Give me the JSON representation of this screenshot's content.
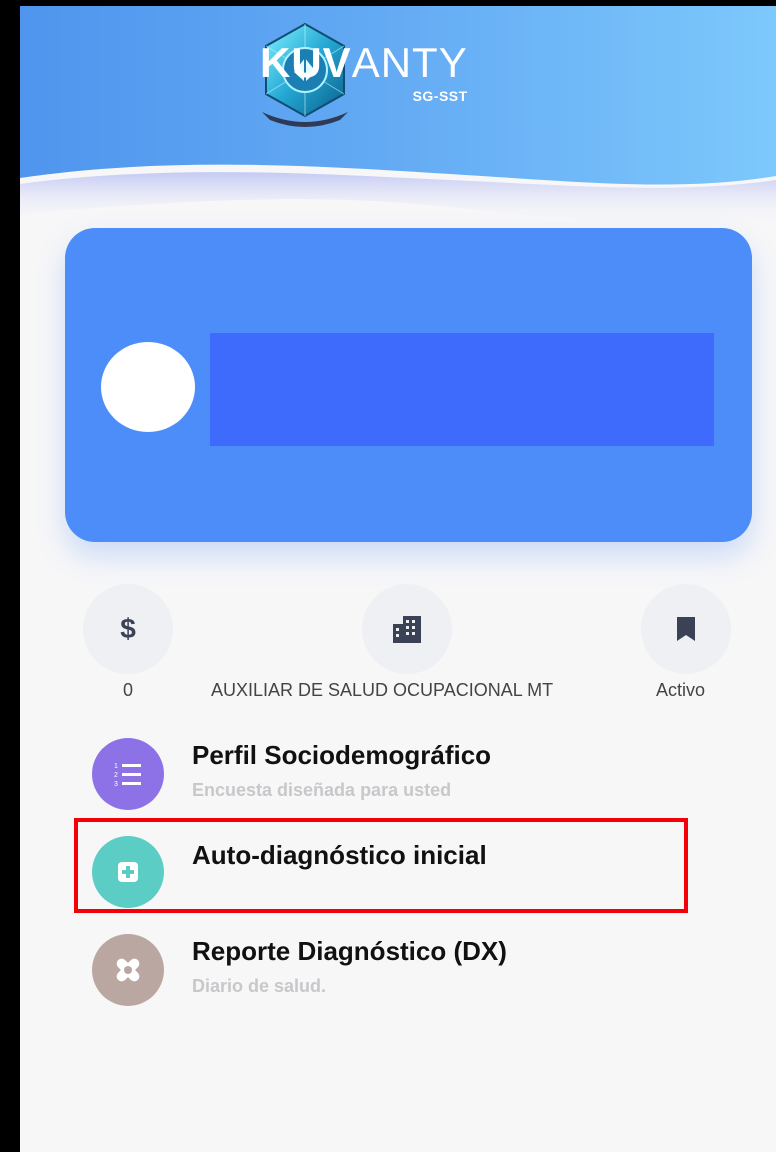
{
  "app": {
    "brand": "KUV",
    "brand_rest": "ANTY",
    "brand_sub": "SG-SST"
  },
  "stats": [
    {
      "icon": "dollar-icon",
      "value": "0"
    },
    {
      "icon": "building-icon",
      "value": "AUXILIAR DE SALUD OCUPACIONAL MT"
    },
    {
      "icon": "bookmark-icon",
      "value": "Activo"
    }
  ],
  "menu": [
    {
      "title": "Perfil Sociodemográfico",
      "subtitle": "Encuesta diseñada para usted",
      "icon": "numbered-list-icon",
      "color": "#8c72e6"
    },
    {
      "title": "Auto-diagnóstico inicial",
      "subtitle": "",
      "icon": "medical-plus-icon",
      "color": "#5bcdc4"
    },
    {
      "title": "Reporte Diagnóstico (DX)",
      "subtitle": "Diario de salud.",
      "icon": "bandage-icon",
      "color": "#bba7a2"
    }
  ],
  "colors": {
    "card": "#4d8df9",
    "name_block": "#3f6bfd",
    "highlight": "#f40009"
  }
}
